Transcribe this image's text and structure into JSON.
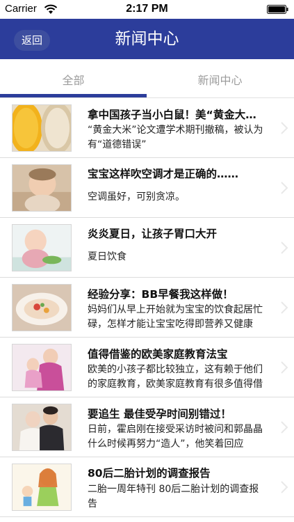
{
  "status_bar": {
    "carrier": "Carrier",
    "time": "2:17 PM",
    "wifi_icon": "wifi-icon",
    "battery_icon": "battery-full-icon"
  },
  "nav": {
    "back_label": "返回",
    "title": "新闻中心",
    "bar_color": "#2c3d9b"
  },
  "tabs": [
    {
      "label": "全部",
      "active": true
    },
    {
      "label": "新闻中心",
      "active": false
    }
  ],
  "news": [
    {
      "title": "拿中国孩子当小白鼠！美“黄金大米”论文遭学术期刊撤稿",
      "desc": "“黄金大米”论文遭学术期刊撤稿，被认为有“道德错误”",
      "thumb_icon": "rice-bowls-photo"
    },
    {
      "title": "宝宝这样吹空调才是正确的……",
      "desc": "空调虽好，可别贪凉。",
      "thumb_icon": "baby-portrait-photo"
    },
    {
      "title": "炎炎夏日，让孩子胃口大开",
      "desc": "夏日饮食",
      "thumb_icon": "toddler-eating-photo"
    },
    {
      "title": "经验分享：BB早餐我这样做！",
      "desc": "妈妈们从早上开始就为宝宝的饮食起居忙碌，怎样才能让宝宝吃得即营养又健康",
      "thumb_icon": "breakfast-dish-photo"
    },
    {
      "title": "值得借鉴的欧美家庭教育法宝",
      "desc": "欧美的小孩子都比较独立，这有赖于他们的家庭教育，欧美家庭教育有很多值得借鉴",
      "thumb_icon": "mother-child-photo"
    },
    {
      "title": "要追生 最佳受孕时间别错过！",
      "desc": "日前，霍启刚在接受采访时被问和郭晶晶什么时候再努力“造人”，他笑着回应",
      "thumb_icon": "couple-photo"
    },
    {
      "title": "80后二胎计划的调查报告",
      "desc": "二胎一周年特刊 80后二胎计划的调查报告",
      "thumb_icon": "cartoon-family-illustration"
    }
  ]
}
